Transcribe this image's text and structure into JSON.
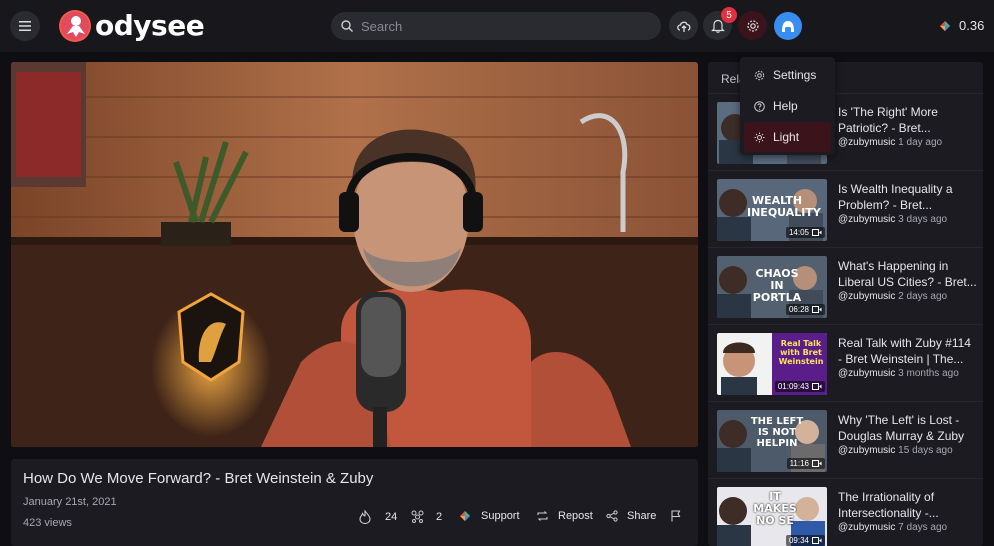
{
  "header": {
    "logo_text": "odysee",
    "search_placeholder": "Search",
    "notifications_count": "5",
    "balance": "0.36"
  },
  "video": {
    "title": "How Do We Move Forward? - Bret Weinstein & Zuby",
    "date": "January 21st, 2021",
    "views": "423 views",
    "fire_count": "24",
    "slime_count": "2",
    "support_label": "Support",
    "repost_label": "Repost",
    "share_label": "Share"
  },
  "sidebar": {
    "heading": "Rela",
    "items": [
      {
        "title": "Is 'The Right' More Patriotic? - Bret...",
        "channel": "@zubymusic",
        "age": "1 day ago",
        "duration": "",
        "thumb_text": ""
      },
      {
        "title": "Is Wealth Inequality a Problem? - Bret...",
        "channel": "@zubymusic",
        "age": "3 days ago",
        "duration": "14:05",
        "thumb_text": "WEALTH INEQUALITY"
      },
      {
        "title": "What's Happening in Liberal US Cities? - Bret...",
        "channel": "@zubymusic",
        "age": "2 days ago",
        "duration": "06:28",
        "thumb_text": "CHAOS IN PORTLA"
      },
      {
        "title": "Real Talk with Zuby #114 - Bret Weinstein | The...",
        "channel": "@zubymusic",
        "age": "3 months ago",
        "duration": "01:09:43",
        "thumb_text": "Real Talk with Bret Weinstein"
      },
      {
        "title": "Why 'The Left' is Lost - Douglas Murray & Zuby",
        "channel": "@zubymusic",
        "age": "15 days ago",
        "duration": "11:16",
        "thumb_text": "THE LEFT IS NOT HELPIN"
      },
      {
        "title": "The Irrationality of Intersectionality -...",
        "channel": "@zubymusic",
        "age": "7 days ago",
        "duration": "09:34",
        "thumb_text": "IT MAKES NO SE"
      }
    ]
  },
  "dropdown": {
    "settings_label": "Settings",
    "help_label": "Help",
    "light_label": "Light"
  },
  "colors": {
    "accent": "#e0323e",
    "background": "#0e0e13",
    "panel": "#1b1b21",
    "avatar": "#3a8df0"
  }
}
